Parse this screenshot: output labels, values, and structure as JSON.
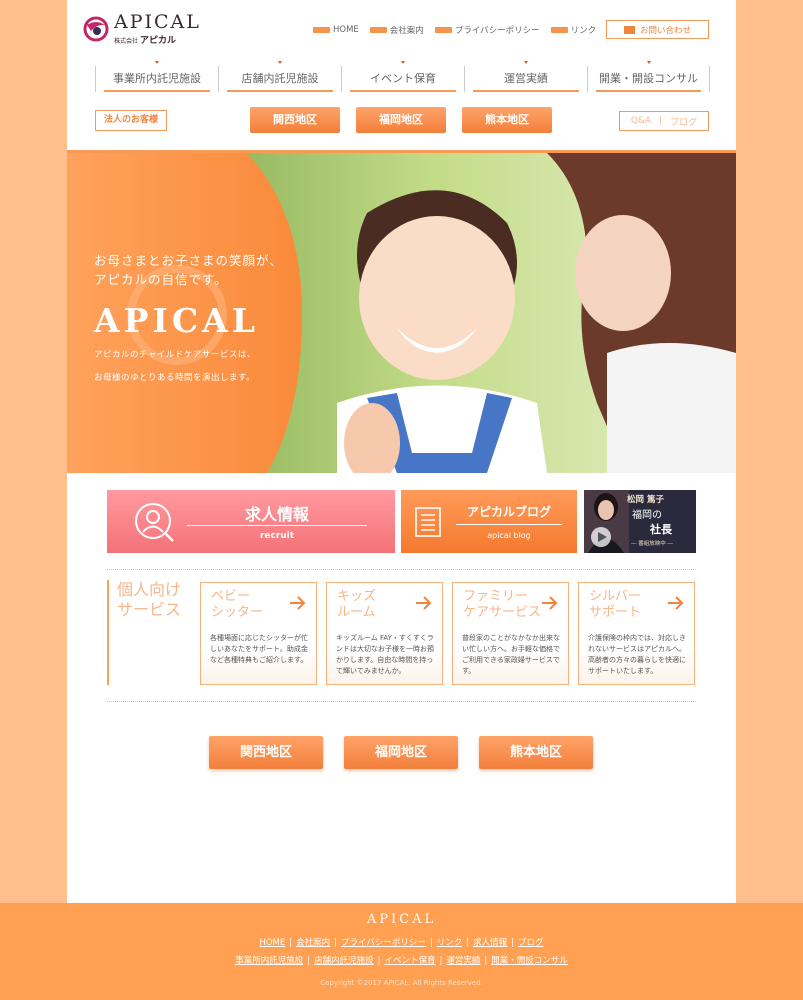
{
  "header": {
    "logo": {
      "brand": "APICAL",
      "sub_prefix": "株式会社",
      "sub_name": "アピカル"
    },
    "top_nav": [
      "HOME",
      "会社案内",
      "プライバシーポリシー",
      "リンク"
    ],
    "contact_label": "お問い合わせ",
    "main_nav": [
      "事業所内託児施設",
      "店舗内託児施設",
      "イベント保育",
      "運営実績",
      "開業・開設コンサル"
    ],
    "corporate_label": "法人のお客様",
    "regions": [
      "関西地区",
      "福岡地区",
      "熊本地区"
    ],
    "qa_label": "Q&A",
    "blog_label": "ブログ"
  },
  "hero": {
    "tagline_1": "お母さまとお子さまの笑顔が、",
    "tagline_2": "アピカルの自信です。",
    "brand": "APICAL",
    "desc_1": "アピカルのチャイルドケアサービスは、",
    "desc_2": "お母様のゆとりある時間を演出します。"
  },
  "banners": {
    "recruit_title": "求人情報",
    "recruit_sub": "recruit",
    "blog_title": "アピカルブログ",
    "blog_sub": "apical blog",
    "video_name": "松岡 篤子",
    "video_caption_1": "福岡の",
    "video_caption_2": "社長",
    "video_caption_3": "― 番組放映中 ―"
  },
  "services": {
    "heading_1": "個人向け",
    "heading_2": "サービス",
    "cards": [
      {
        "title": "ベビー\nシッター",
        "body": "各種場面に応じたシッターが忙しいあなたをサポート。助成金など各種特典もご紹介します。"
      },
      {
        "title": "キッズ\nルーム",
        "body": "キッズルーム FAY・すくすくランドは大切なお子様を一時お預かりします。自由な時間を持って輝いてみませんか。"
      },
      {
        "title": "ファミリー\nケアサービス",
        "body": "普段家のことがなかなか出来ない忙しい方へ。お手軽な価格でご利用できる家政婦サービスです。"
      },
      {
        "title": "シルバー\nサポート",
        "body": "介護保険の枠内では、対応しきれないサービスはアピカルへ。高齢者の方々の暮らしを快適にサポートいたします。"
      }
    ]
  },
  "footer": {
    "brand": "APICAL",
    "links_row1": [
      "HOME",
      "会社案内",
      "プライバシーポリシー",
      "リンク",
      "求人情報",
      "ブログ"
    ],
    "links_row2": [
      "事業所内託児施設",
      "店舗内託児施設",
      "イベント保育",
      "運営実績",
      "開業・開設コンサル"
    ],
    "copyright": "Copyright ©2017 APICAL. All Rights Reserved."
  },
  "colors": {
    "accent": "#f7944c",
    "footer": "#ffa052",
    "background": "#ffbf8c",
    "recruit": "#f47278"
  }
}
